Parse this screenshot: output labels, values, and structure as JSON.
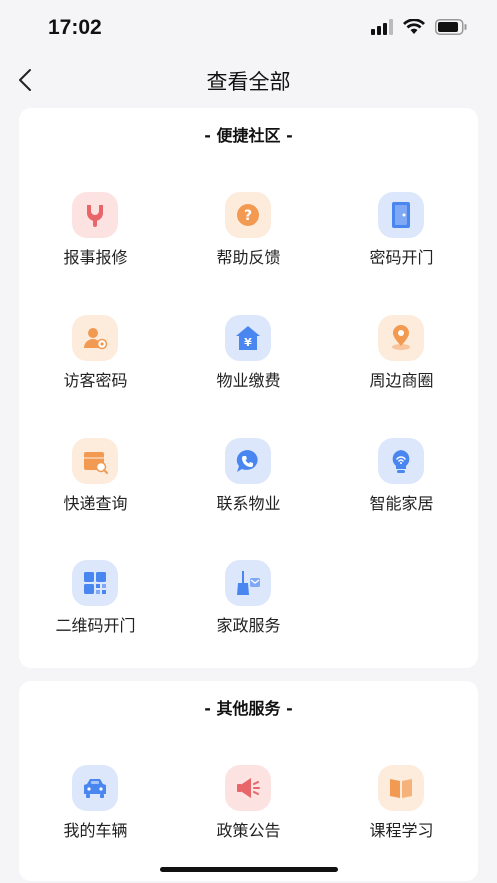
{
  "status": {
    "time": "17:02"
  },
  "nav": {
    "title": "查看全部"
  },
  "sections": [
    {
      "title": "- 便捷社区 -",
      "items": [
        {
          "label": "报事报修",
          "icon": "wrench-icon",
          "color": "#e8656a"
        },
        {
          "label": "帮助反馈",
          "icon": "question-icon",
          "color": "#f29a52"
        },
        {
          "label": "密码开门",
          "icon": "door-icon",
          "color": "#4a86ef"
        },
        {
          "label": "访客密码",
          "icon": "visitor-icon",
          "color": "#f29a52"
        },
        {
          "label": "物业缴费",
          "icon": "yuan-house-icon",
          "color": "#4a86ef"
        },
        {
          "label": "周边商圈",
          "icon": "location-pin-icon",
          "color": "#f29a52"
        },
        {
          "label": "快递查询",
          "icon": "package-search-icon",
          "color": "#f29a52"
        },
        {
          "label": "联系物业",
          "icon": "phone-chat-icon",
          "color": "#4a86ef"
        },
        {
          "label": "智能家居",
          "icon": "smart-bulb-icon",
          "color": "#4a86ef"
        },
        {
          "label": "二维码开门",
          "icon": "qr-code-icon",
          "color": "#4a86ef"
        },
        {
          "label": "家政服务",
          "icon": "broom-icon",
          "color": "#4a86ef"
        }
      ]
    },
    {
      "title": "- 其他服务 -",
      "items": [
        {
          "label": "我的车辆",
          "icon": "car-icon",
          "color": "#4a86ef"
        },
        {
          "label": "政策公告",
          "icon": "megaphone-icon",
          "color": "#e8656a"
        },
        {
          "label": "课程学习",
          "icon": "book-icon",
          "color": "#f29a52"
        }
      ]
    }
  ]
}
